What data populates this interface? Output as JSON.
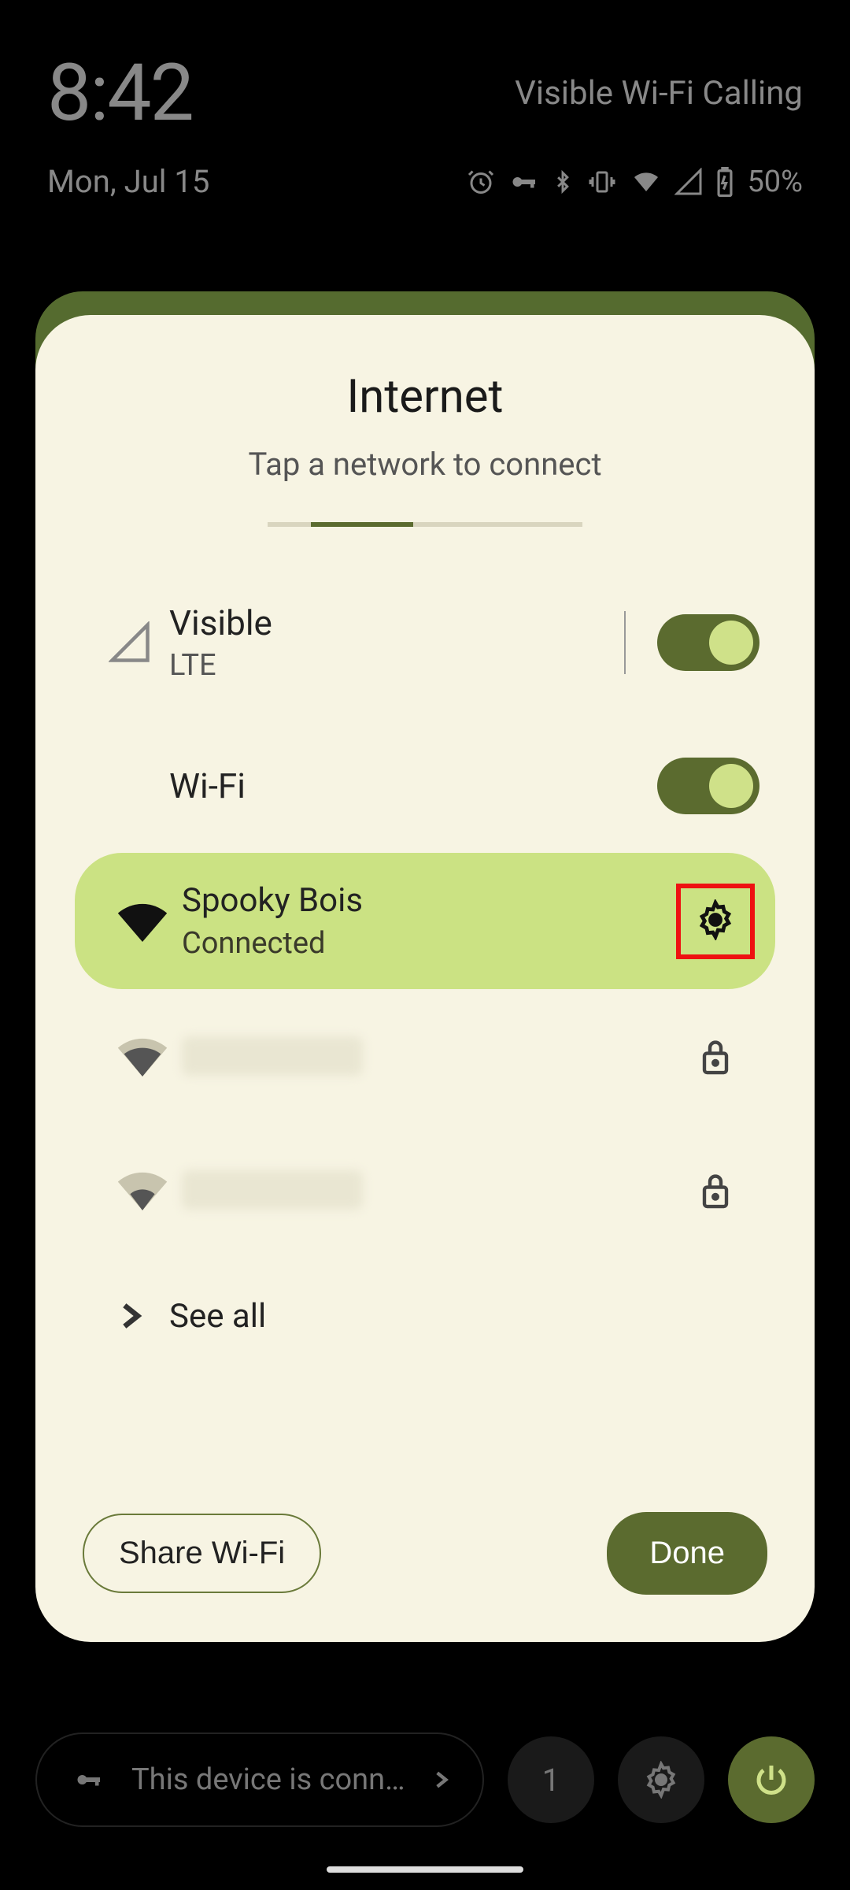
{
  "status": {
    "time": "8:42",
    "calling": "Visible Wi-Fi Calling",
    "date": "Mon, Jul 15",
    "battery": "50%"
  },
  "sheet": {
    "title": "Internet",
    "subtitle": "Tap a network to connect"
  },
  "mobile": {
    "name": "Visible",
    "type": "LTE",
    "enabled": true
  },
  "wifi": {
    "label": "Wi-Fi",
    "enabled": true
  },
  "networks": {
    "connected": {
      "name": "Spooky Bois",
      "status": "Connected"
    },
    "others": [
      {
        "name": "",
        "secured": true,
        "strength": 3
      },
      {
        "name": "",
        "secured": true,
        "strength": 2
      }
    ]
  },
  "see_all": "See all",
  "buttons": {
    "share": "Share Wi-Fi",
    "done": "Done"
  },
  "qs_footer": {
    "message": "This device is conn…",
    "page": "1"
  }
}
